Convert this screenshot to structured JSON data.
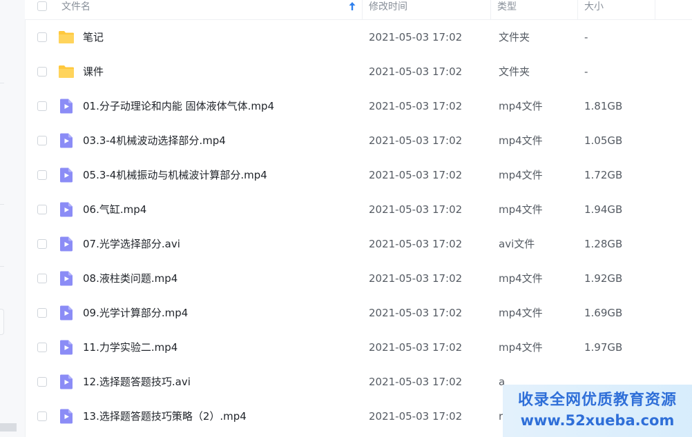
{
  "header": {
    "name": "文件名",
    "modified": "修改时间",
    "type": "类型",
    "size": "大小"
  },
  "colors": {
    "folder": "#FFC83D",
    "video_icon": "#8B8CF6",
    "accent": "#2f80ed",
    "watermark_text": "#2f6fd8"
  },
  "files": [
    {
      "name": "笔记",
      "modified": "2021-05-03 17:02",
      "type": "文件夹",
      "size": "-",
      "icon": "folder-icon"
    },
    {
      "name": "课件",
      "modified": "2021-05-03 17:02",
      "type": "文件夹",
      "size": "-",
      "icon": "folder-icon"
    },
    {
      "name": "01.分子动理论和内能 固体液体气体.mp4",
      "modified": "2021-05-03 17:02",
      "type": "mp4文件",
      "size": "1.81GB",
      "icon": "video-file-icon"
    },
    {
      "name": "03.3-4机械波动选择部分.mp4",
      "modified": "2021-05-03 17:02",
      "type": "mp4文件",
      "size": "1.05GB",
      "icon": "video-file-icon"
    },
    {
      "name": "05.3-4机械振动与机械波计算部分.mp4",
      "modified": "2021-05-03 17:02",
      "type": "mp4文件",
      "size": "1.72GB",
      "icon": "video-file-icon"
    },
    {
      "name": "06.气缸.mp4",
      "modified": "2021-05-03 17:02",
      "type": "mp4文件",
      "size": "1.94GB",
      "icon": "video-file-icon"
    },
    {
      "name": "07.光学选择部分.avi",
      "modified": "2021-05-03 17:02",
      "type": "avi文件",
      "size": "1.28GB",
      "icon": "video-file-icon"
    },
    {
      "name": "08.液柱类问题.mp4",
      "modified": "2021-05-03 17:02",
      "type": "mp4文件",
      "size": "1.92GB",
      "icon": "video-file-icon"
    },
    {
      "name": "09.光学计算部分.mp4",
      "modified": "2021-05-03 17:02",
      "type": "mp4文件",
      "size": "1.69GB",
      "icon": "video-file-icon"
    },
    {
      "name": "11.力学实验二.mp4",
      "modified": "2021-05-03 17:02",
      "type": "mp4文件",
      "size": "1.97GB",
      "icon": "video-file-icon"
    },
    {
      "name": "12.选择题答题技巧.avi",
      "modified": "2021-05-03 17:02",
      "type": "a",
      "size": "",
      "icon": "video-file-icon"
    },
    {
      "name": "13.选择题答题技巧策略（2）.mp4",
      "modified": "2021-05-03 17:02",
      "type": "r",
      "size": "",
      "icon": "video-file-icon"
    }
  ],
  "watermark": {
    "line1": "收录全网优质教育资源",
    "line2": "www.52xueba.com"
  }
}
